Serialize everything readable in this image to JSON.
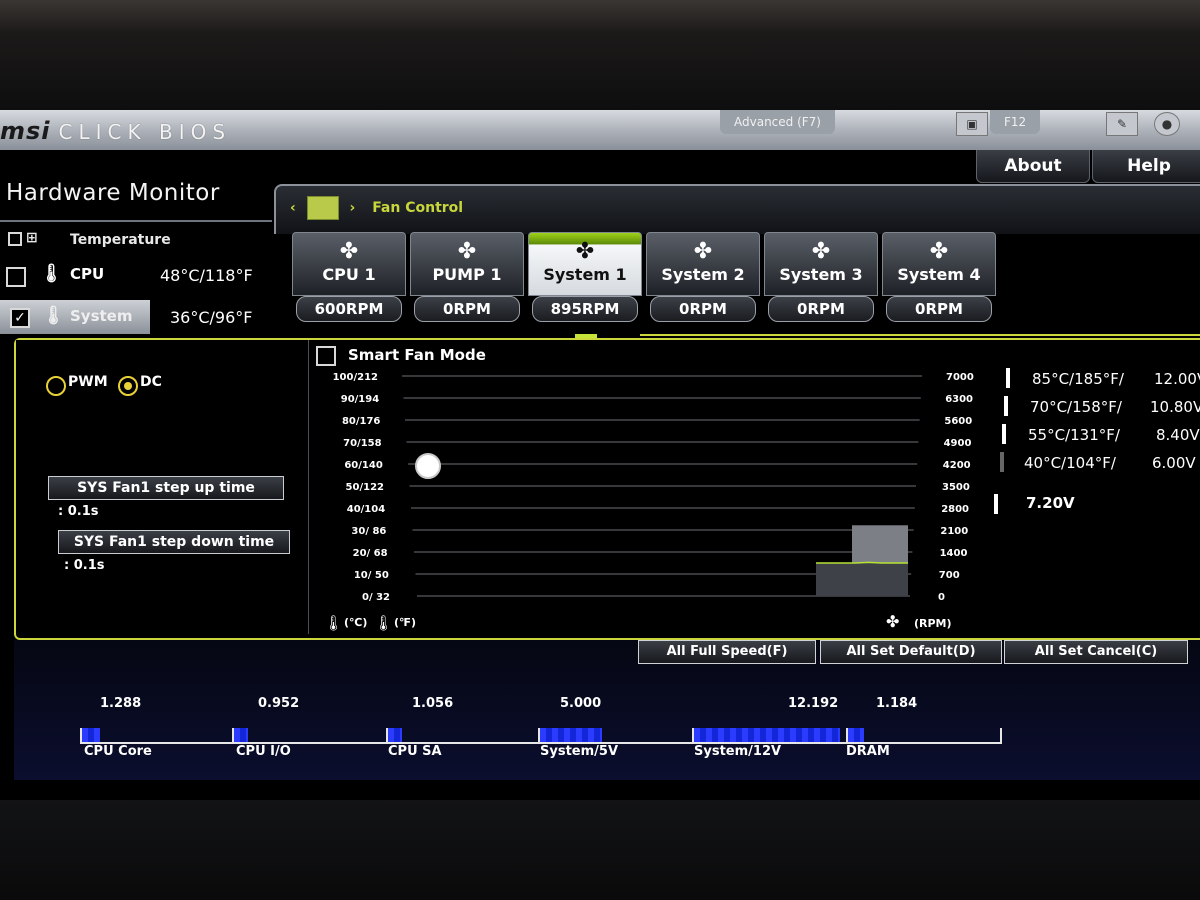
{
  "header": {
    "logo_main": "msi",
    "logo_sub": "CLICK BIOS",
    "tab_advanced": "Advanced (F7)",
    "tab_f12": "F12",
    "about": "About",
    "help": "Help"
  },
  "page_title": "Hardware Monitor",
  "sensors": {
    "header": "Temperature",
    "rows": [
      {
        "label": "CPU",
        "value": "48°C/118°F"
      },
      {
        "label": "System",
        "value": "36°C/96°F"
      }
    ]
  },
  "fan_control": {
    "breadcrumb": "Fan Control",
    "tabs": [
      {
        "name": "CPU 1",
        "rpm": "600RPM"
      },
      {
        "name": "PUMP 1",
        "rpm": "0RPM"
      },
      {
        "name": "System 1",
        "rpm": "895RPM"
      },
      {
        "name": "System 2",
        "rpm": "0RPM"
      },
      {
        "name": "System 3",
        "rpm": "0RPM"
      },
      {
        "name": "System 4",
        "rpm": "0RPM"
      }
    ],
    "mode": {
      "pwm": "PWM",
      "dc": "DC",
      "selected": "DC"
    },
    "step_up_label": "SYS Fan1 step up time",
    "step_up_value": ": 0.1s",
    "step_down_label": "SYS Fan1 step down time",
    "step_down_value": ": 0.1s",
    "smart_fan_label": "Smart Fan Mode",
    "temp_axis_label_c": "(℃)",
    "temp_axis_label_f": "(℉)",
    "rpm_axis_label": "(RPM)",
    "legend": [
      {
        "temp": "85°C/185°F/",
        "volt": "12.00V"
      },
      {
        "temp": "70°C/158°F/",
        "volt": "10.80V"
      },
      {
        "temp": "55°C/131°F/",
        "volt": "8.40V"
      },
      {
        "temp": "40°C/104°F/",
        "volt": "6.00V"
      }
    ],
    "current_voltage": "7.20V"
  },
  "actions": {
    "full_speed": "All Full Speed(F)",
    "set_default": "All Set Default(D)",
    "set_cancel": "All Set Cancel(C)"
  },
  "voltages": [
    {
      "name": "CPU Core",
      "value": "1.288"
    },
    {
      "name": "CPU I/O",
      "value": "0.952"
    },
    {
      "name": "CPU SA",
      "value": "1.056"
    },
    {
      "name": "System/5V",
      "value": "5.000"
    },
    {
      "name": "System/12V",
      "value": "12.192"
    },
    {
      "name": "DRAM",
      "value": "1.184"
    }
  ],
  "chart_data": {
    "type": "line",
    "title": "Smart Fan Mode",
    "temp_ticks": [
      "100/212",
      "90/194",
      "80/176",
      "70/158",
      "60/140",
      "50/122",
      "40/104",
      "30/ 86",
      "20/ 68",
      "10/ 50",
      "0/ 32"
    ],
    "rpm_ticks": [
      "7000",
      "6300",
      "5600",
      "4900",
      "4200",
      "3500",
      "2800",
      "2100",
      "1400",
      "700",
      "0"
    ],
    "current_temp_marker_c": 60,
    "rpm_history": [
      1050,
      1050,
      1050,
      1050,
      1070,
      1050,
      1050,
      1050
    ]
  }
}
